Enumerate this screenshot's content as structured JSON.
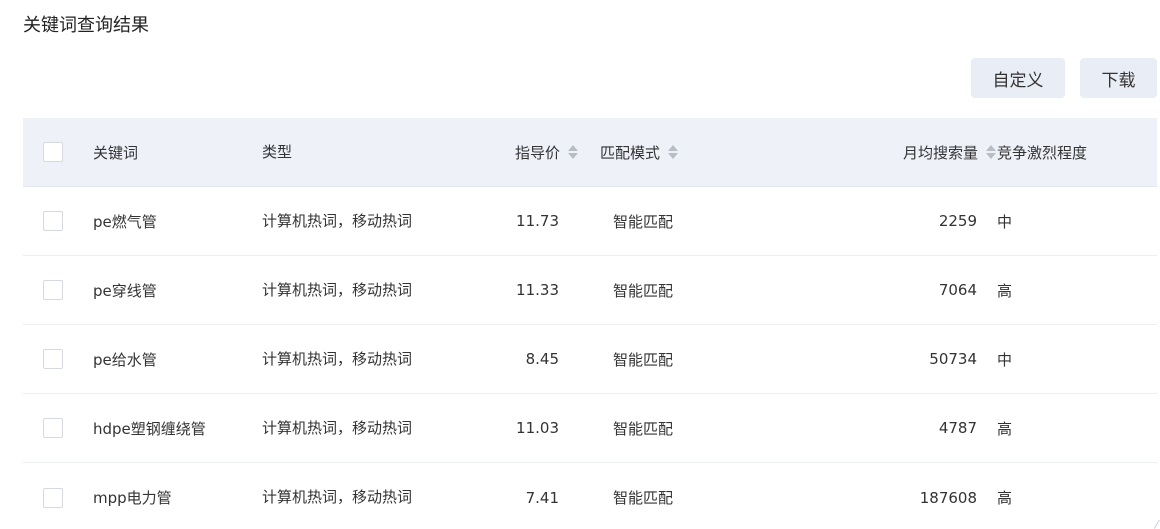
{
  "page": {
    "title": "关键词查询结果"
  },
  "toolbar": {
    "customize_label": "自定义",
    "download_label": "下载"
  },
  "table": {
    "headers": {
      "keyword": "关键词",
      "type": "类型",
      "price": "指导价",
      "match": "匹配模式",
      "volume": "月均搜索量",
      "competition": "竞争激烈程度"
    },
    "rows": [
      {
        "keyword": "pe燃气管",
        "type": "计算机热词，移动热词",
        "price": "11.73",
        "match": "智能匹配",
        "volume": "2259",
        "competition": "中"
      },
      {
        "keyword": "pe穿线管",
        "type": "计算机热词，移动热词",
        "price": "11.33",
        "match": "智能匹配",
        "volume": "7064",
        "competition": "高"
      },
      {
        "keyword": "pe给水管",
        "type": "计算机热词，移动热词",
        "price": "8.45",
        "match": "智能匹配",
        "volume": "50734",
        "competition": "中"
      },
      {
        "keyword": "hdpe塑钢缠绕管",
        "type": "计算机热词，移动热词",
        "price": "11.03",
        "match": "智能匹配",
        "volume": "4787",
        "competition": "高"
      },
      {
        "keyword": "mpp电力管",
        "type": "计算机热词，移动热词",
        "price": "7.41",
        "match": "智能匹配",
        "volume": "187608",
        "competition": "高"
      }
    ]
  },
  "icons": {
    "sort": "sort-caret-icon",
    "checkbox": "checkbox-icon"
  },
  "colors": {
    "header_bg": "#eef1f8",
    "button_bg": "#e9edf5",
    "border": "#d6d9df"
  }
}
